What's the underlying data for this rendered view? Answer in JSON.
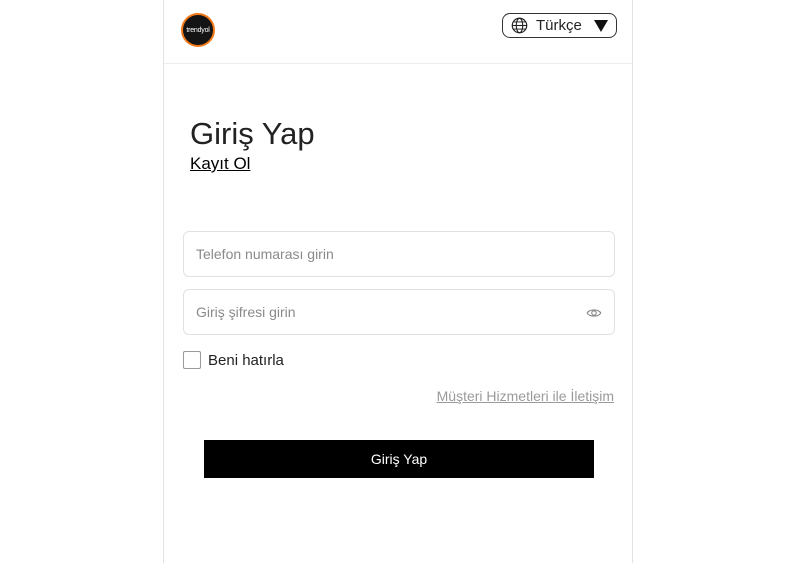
{
  "header": {
    "logo_text": "trendyol",
    "language": {
      "selected": "Türkçe",
      "icon": "globe-icon",
      "dropdown_icon": "caret-down-icon"
    }
  },
  "main": {
    "title": "Giriş Yap",
    "signup_link": "Kayıt Ol",
    "phone_field": {
      "placeholder": "Telefon numarası girin",
      "value": ""
    },
    "password_field": {
      "placeholder": "Giriş şifresi girin",
      "value": "",
      "toggle_icon": "eye-icon"
    },
    "remember_me": {
      "label": "Beni hatırla",
      "checked": false
    },
    "support_link": "Müşteri Hizmetleri ile İletişim",
    "submit_label": "Giriş Yap"
  },
  "colors": {
    "primary_button": "#000000",
    "logo_ring": "#f27a1a",
    "link_muted": "#9a9a9a"
  }
}
